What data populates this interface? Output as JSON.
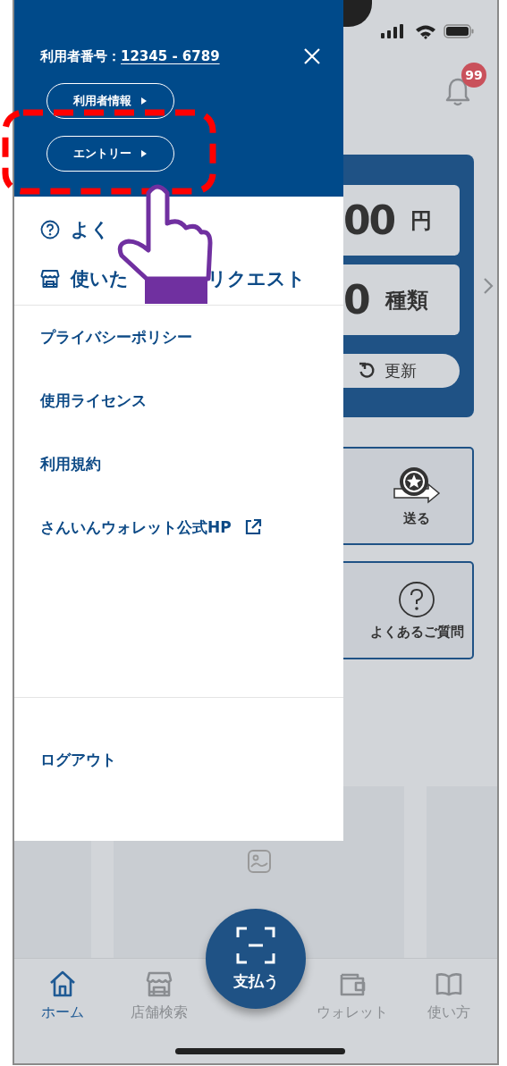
{
  "app": {
    "notification_badge": "99",
    "balance": {
      "amount": "00",
      "unit": "円"
    },
    "count": {
      "amount": "0",
      "unit": "種類"
    },
    "refresh": "更新",
    "actions": [
      {
        "kind": "send",
        "label": "送る"
      },
      {
        "kind": "faq",
        "label": "よくあるご質問"
      }
    ],
    "nav": [
      {
        "kind": "home",
        "label": "ホーム",
        "selected": true
      },
      {
        "kind": "shop",
        "label": "店舗検索",
        "selected": false
      },
      {
        "kind": "pay",
        "label": "支払う",
        "selected": false
      },
      {
        "kind": "wallet",
        "label": "ウォレット",
        "selected": false
      },
      {
        "kind": "book",
        "label": "使い方",
        "selected": false
      }
    ]
  },
  "drawer": {
    "user_number_label": "利用者番号：",
    "user_number": "12345 - 6789",
    "header_buttons": [
      {
        "label": "利用者情報",
        "highlighted": false
      },
      {
        "label": "エントリー",
        "highlighted": true
      }
    ],
    "top_items": [
      {
        "kind": "faq",
        "parts": [
          "よく"
        ]
      },
      {
        "kind": "shop",
        "parts": [
          "使いた",
          "リクエスト"
        ]
      }
    ],
    "links": [
      {
        "label": "プライバシーポリシー",
        "external": false
      },
      {
        "label": "使用ライセンス",
        "external": false
      },
      {
        "label": "利用規約",
        "external": false
      },
      {
        "label": "さんいんウォレット公式HP",
        "external": true
      }
    ],
    "logout": "ログアウト"
  }
}
